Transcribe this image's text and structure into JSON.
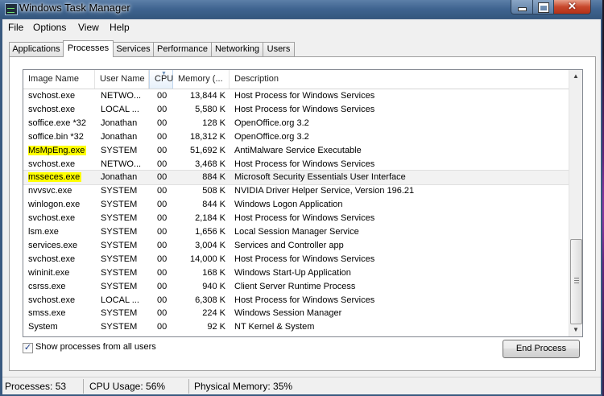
{
  "window": {
    "title": "Windows Task Manager",
    "min_label": "",
    "close_label": "✕"
  },
  "menu": [
    "File",
    "Options",
    "View",
    "Help"
  ],
  "tabs": [
    "Applications",
    "Processes",
    "Services",
    "Performance",
    "Networking",
    "Users"
  ],
  "active_tab": "Processes",
  "columns": [
    "Image Name",
    "User Name",
    "CPU",
    "Memory (...",
    "Description"
  ],
  "sorted_column": "CPU",
  "processes": [
    {
      "name": "svchost.exe",
      "user": "NETWO...",
      "cpu": "00",
      "mem": "13,844 K",
      "desc": "Host Process for Windows Services",
      "highlight": false
    },
    {
      "name": "svchost.exe",
      "user": "LOCAL ...",
      "cpu": "00",
      "mem": "5,580 K",
      "desc": "Host Process for Windows Services",
      "highlight": false
    },
    {
      "name": "soffice.exe *32",
      "user": "Jonathan",
      "cpu": "00",
      "mem": "128 K",
      "desc": "OpenOffice.org 3.2",
      "highlight": false
    },
    {
      "name": "soffice.bin *32",
      "user": "Jonathan",
      "cpu": "00",
      "mem": "18,312 K",
      "desc": "OpenOffice.org 3.2",
      "highlight": false
    },
    {
      "name": "MsMpEng.exe",
      "user": "SYSTEM",
      "cpu": "00",
      "mem": "51,692 K",
      "desc": "AntiMalware Service Executable",
      "highlight": true
    },
    {
      "name": "svchost.exe",
      "user": "NETWO...",
      "cpu": "00",
      "mem": "3,468 K",
      "desc": "Host Process for Windows Services",
      "highlight": false
    },
    {
      "name": "msseces.exe",
      "user": "Jonathan",
      "cpu": "00",
      "mem": "884 K",
      "desc": "Microsoft Security Essentials User Interface",
      "highlight": true,
      "selected": true
    },
    {
      "name": "nvvsvc.exe",
      "user": "SYSTEM",
      "cpu": "00",
      "mem": "508 K",
      "desc": "NVIDIA Driver Helper Service, Version 196.21",
      "highlight": false
    },
    {
      "name": "winlogon.exe",
      "user": "SYSTEM",
      "cpu": "00",
      "mem": "844 K",
      "desc": "Windows Logon Application",
      "highlight": false
    },
    {
      "name": "svchost.exe",
      "user": "SYSTEM",
      "cpu": "00",
      "mem": "2,184 K",
      "desc": "Host Process for Windows Services",
      "highlight": false
    },
    {
      "name": "lsm.exe",
      "user": "SYSTEM",
      "cpu": "00",
      "mem": "1,656 K",
      "desc": "Local Session Manager Service",
      "highlight": false
    },
    {
      "name": "services.exe",
      "user": "SYSTEM",
      "cpu": "00",
      "mem": "3,004 K",
      "desc": "Services and Controller app",
      "highlight": false
    },
    {
      "name": "svchost.exe",
      "user": "SYSTEM",
      "cpu": "00",
      "mem": "14,000 K",
      "desc": "Host Process for Windows Services",
      "highlight": false
    },
    {
      "name": "wininit.exe",
      "user": "SYSTEM",
      "cpu": "00",
      "mem": "168 K",
      "desc": "Windows Start-Up Application",
      "highlight": false
    },
    {
      "name": "csrss.exe",
      "user": "SYSTEM",
      "cpu": "00",
      "mem": "940 K",
      "desc": "Client Server Runtime Process",
      "highlight": false
    },
    {
      "name": "svchost.exe",
      "user": "LOCAL ...",
      "cpu": "00",
      "mem": "6,308 K",
      "desc": "Host Process for Windows Services",
      "highlight": false
    },
    {
      "name": "smss.exe",
      "user": "SYSTEM",
      "cpu": "00",
      "mem": "224 K",
      "desc": "Windows Session Manager",
      "highlight": false
    },
    {
      "name": "System",
      "user": "SYSTEM",
      "cpu": "00",
      "mem": "92 K",
      "desc": "NT Kernel & System",
      "highlight": false
    }
  ],
  "highlight_color": "#ffff00",
  "show_all_users_label": "Show processes from all users",
  "show_all_users_checked": true,
  "end_process_label": "End Process",
  "status": {
    "processes": "Processes: 53",
    "cpu": "CPU Usage: 56%",
    "memory": "Physical Memory: 35%"
  }
}
